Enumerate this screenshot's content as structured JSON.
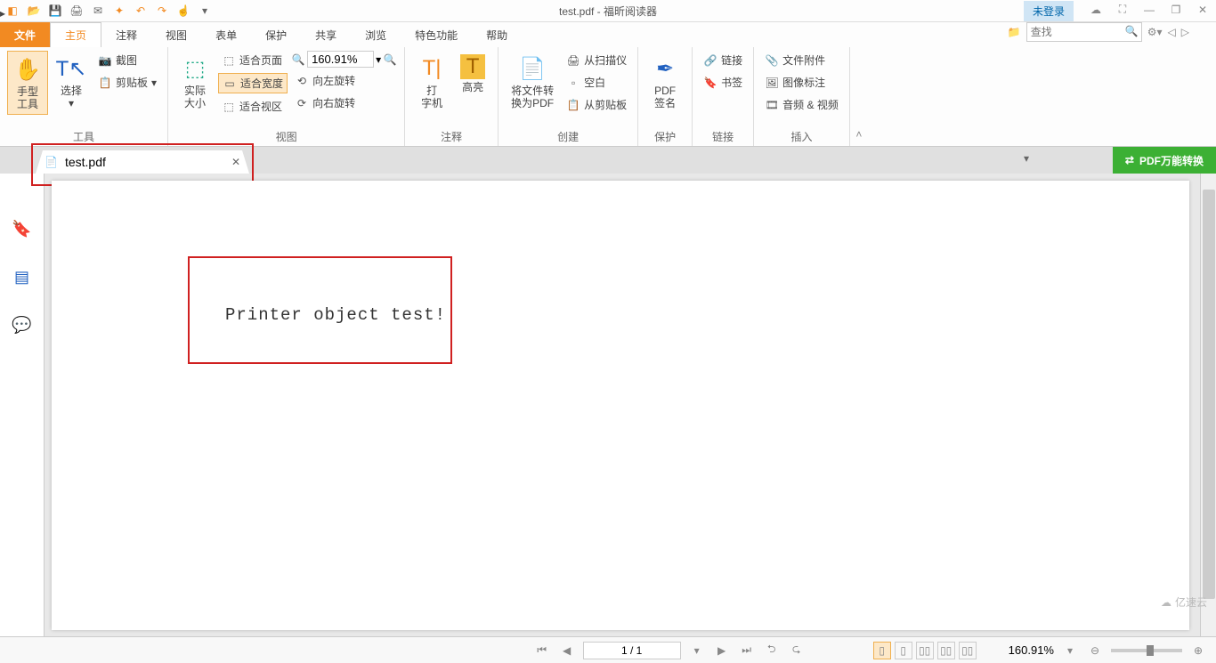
{
  "title": "test.pdf - 福昕阅读器",
  "login_label": "未登录",
  "menu": {
    "file": "文件",
    "home": "主页",
    "comment": "注释",
    "view": "视图",
    "form": "表单",
    "protect": "保护",
    "share": "共享",
    "browse": "浏览",
    "feature": "特色功能",
    "help": "帮助"
  },
  "search_placeholder": "查找",
  "ribbon": {
    "tools_group": "工具",
    "hand_tool": "手型\n工具",
    "select_tool": "选择",
    "screenshot": "截图",
    "clipboard": "剪贴板",
    "view_group": "视图",
    "actual_size": "实际\n大小",
    "fit_page": "适合页面",
    "fit_width": "适合宽度",
    "fit_visible": "适合视区",
    "rotate_left": "向左旋转",
    "rotate_right": "向右旋转",
    "zoom_value": "160.91%",
    "comment_group": "注释",
    "typewriter": "打\n字机",
    "highlight": "高亮",
    "create_group": "创建",
    "convert_pdf": "将文件转\n换为PDF",
    "from_scanner": "从扫描仪",
    "blank": "空白",
    "from_clipboard": "从剪贴板",
    "protect_group": "保护",
    "pdf_sign": "PDF\n签名",
    "link_group": "链接",
    "link": "链接",
    "bookmark": "书签",
    "insert_group": "插入",
    "file_attachment": "文件附件",
    "image_annotation": "图像标注",
    "audio_video": "音频 & 视频"
  },
  "doc_tab": {
    "filename": "test.pdf"
  },
  "pdf_banner": "PDF万能转换",
  "document_text": "Printer object test!",
  "statusbar": {
    "page_indicator": "1 / 1",
    "zoom": "160.91%"
  },
  "watermark": "亿速云",
  "colors": {
    "accent_orange": "#f28a22",
    "highlight_red": "#d02020",
    "banner_green": "#3cb034"
  }
}
